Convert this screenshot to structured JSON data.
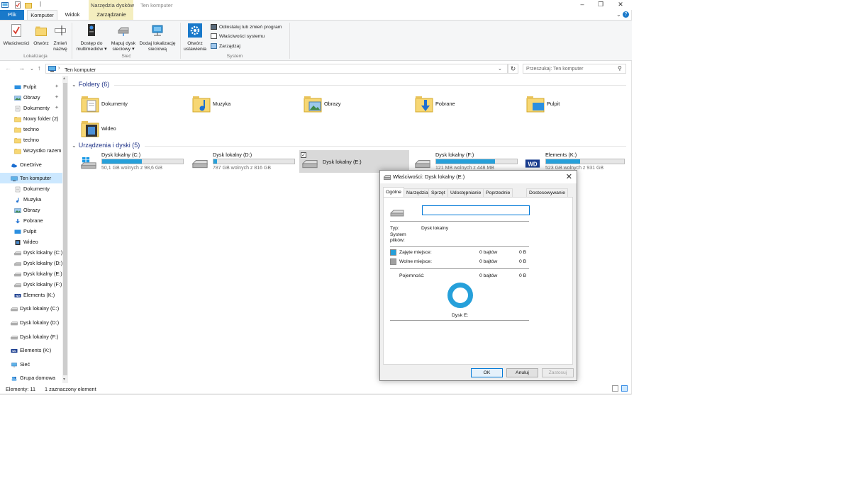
{
  "window": {
    "context_group": "Narzędzia dysków",
    "title": "Ten komputer"
  },
  "tabs": [
    "Plik",
    "Komputer",
    "Widok",
    "Zarządzanie"
  ],
  "ribbon": {
    "lokalizacja": {
      "label": "Lokalizacja",
      "buttons": [
        [
          "Właściwości",
          ""
        ],
        [
          "Otwórz",
          ""
        ],
        [
          "Zmień",
          "nazwę"
        ]
      ]
    },
    "siec": {
      "label": "Sieć",
      "buttons": [
        [
          "Dostęp do",
          "multimediów ▾"
        ],
        [
          "Mapuj dysk",
          "sieciowy ▾"
        ],
        [
          "Dodaj lokalizację",
          "sieciową"
        ]
      ]
    },
    "system": {
      "label": "System",
      "open_settings": [
        "Otwórz",
        "ustawienia"
      ],
      "items": [
        "Odinstaluj lub zmień program",
        "Właściwości systemu",
        "Zarządzaj"
      ]
    }
  },
  "address": {
    "path": "Ten komputer",
    "search_placeholder": "Przeszukaj: Ten komputer"
  },
  "sidebar": [
    {
      "label": "Pulpit",
      "icon": "desktop-icon",
      "pinned": true
    },
    {
      "label": "Obrazy",
      "icon": "pictures-icon",
      "pinned": true
    },
    {
      "label": "Dokumenty",
      "icon": "documents-icon",
      "pinned": true
    },
    {
      "label": "Nowy folder (2)",
      "icon": "folder-icon",
      "pinned": false
    },
    {
      "label": "techno",
      "icon": "folder-icon",
      "pinned": false
    },
    {
      "label": "techno",
      "icon": "folder-icon",
      "pinned": false
    },
    {
      "label": "Wszystko razem",
      "icon": "folder-icon",
      "pinned": false
    },
    {
      "label": "OneDrive",
      "icon": "onedrive-icon",
      "pinned": false
    },
    {
      "label": "Ten komputer",
      "icon": "computer-icon",
      "pinned": false,
      "selected": true
    },
    {
      "label": "Dokumenty",
      "icon": "documents-icon",
      "pinned": false
    },
    {
      "label": "Muzyka",
      "icon": "music-icon",
      "pinned": false
    },
    {
      "label": "Obrazy",
      "icon": "pictures-icon",
      "pinned": false
    },
    {
      "label": "Pobrane",
      "icon": "downloads-icon",
      "pinned": false
    },
    {
      "label": "Pulpit",
      "icon": "desktop-icon",
      "pinned": false
    },
    {
      "label": "Wideo",
      "icon": "video-icon",
      "pinned": false
    },
    {
      "label": "Dysk lokalny (C:)",
      "icon": "drive-icon",
      "pinned": false
    },
    {
      "label": "Dysk lokalny (D:)",
      "icon": "drive-icon",
      "pinned": false
    },
    {
      "label": "Dysk lokalny (E:)",
      "icon": "drive-icon",
      "pinned": false
    },
    {
      "label": "Dysk lokalny (F:)",
      "icon": "drive-icon",
      "pinned": false
    },
    {
      "label": "Elements (K:)",
      "icon": "wd-drive-icon",
      "pinned": false
    },
    {
      "label": "Dysk lokalny (C:)",
      "icon": "drive-icon",
      "pinned": false
    },
    {
      "label": "Dysk lokalny (D:)",
      "icon": "drive-icon",
      "pinned": false
    },
    {
      "label": "Dysk lokalny (F:)",
      "icon": "drive-icon",
      "pinned": false
    },
    {
      "label": "Elements (K:)",
      "icon": "wd-drive-icon",
      "pinned": false
    },
    {
      "label": "Sieć",
      "icon": "network-icon",
      "pinned": false
    },
    {
      "label": "Grupa domowa",
      "icon": "homegroup-icon",
      "pinned": false
    }
  ],
  "folders_header": "Foldery (6)",
  "folders": [
    {
      "label": "Dokumenty",
      "icon": "documents-folder-icon"
    },
    {
      "label": "Muzyka",
      "icon": "music-folder-icon"
    },
    {
      "label": "Obrazy",
      "icon": "pictures-folder-icon"
    },
    {
      "label": "Pobrane",
      "icon": "downloads-folder-icon"
    },
    {
      "label": "Pulpit",
      "icon": "desktop-folder-icon"
    },
    {
      "label": "Wideo",
      "icon": "video-folder-icon"
    }
  ],
  "devices_header": "Urządzenia i dyski (5)",
  "devices": [
    {
      "name": "Dysk lokalny (C:)",
      "free": "50,1 GB wolnych z 98,6 GB",
      "used_fraction": 0.49,
      "icon": "windows-drive-icon"
    },
    {
      "name": "Dysk lokalny (D:)",
      "free": "787 GB wolnych z 816 GB",
      "used_fraction": 0.04,
      "icon": "drive-icon"
    },
    {
      "name": "Dysk lokalny (E:)",
      "free": "",
      "used_fraction": null,
      "icon": "drive-icon",
      "selected": true
    },
    {
      "name": "Dysk lokalny (F:)",
      "free": "121 MB wolnych z 448 MB",
      "used_fraction": 0.73,
      "icon": "drive-icon"
    },
    {
      "name": "Elements (K:)",
      "free": "523 GB wolnych z 931 GB",
      "used_fraction": 0.44,
      "icon": "wd-drive-icon"
    }
  ],
  "status": {
    "count": "Elementy: 11",
    "selected": "1 zaznaczony element"
  },
  "dialog": {
    "title": "Właściwości: Dysk lokalny (E:)",
    "tabs": [
      "Ogólne",
      "Narzędzia",
      "Sprzęt",
      "Udostępnianie",
      "Poprzednie wersje",
      "Dostosowywanie"
    ],
    "name_value": "",
    "type_label": "Typ:",
    "type_value": "Dysk lokalny",
    "fs_label": "System plików:",
    "used_label": "Zajęte miejsce:",
    "used_bytes": "0 bajtów",
    "used_size": "0 B",
    "free_label": "Wolne miejsce:",
    "free_bytes": "0 bajtów",
    "free_size": "0 B",
    "capacity_label": "Pojemność:",
    "capacity_bytes": "0 bajtów",
    "capacity_size": "0 B",
    "disk_label": "Dysk E:",
    "ok": "OK",
    "cancel": "Anuluj",
    "apply": "Zastosuj",
    "colors": {
      "used": "#26a0da",
      "free": "#a0a0a0"
    }
  }
}
